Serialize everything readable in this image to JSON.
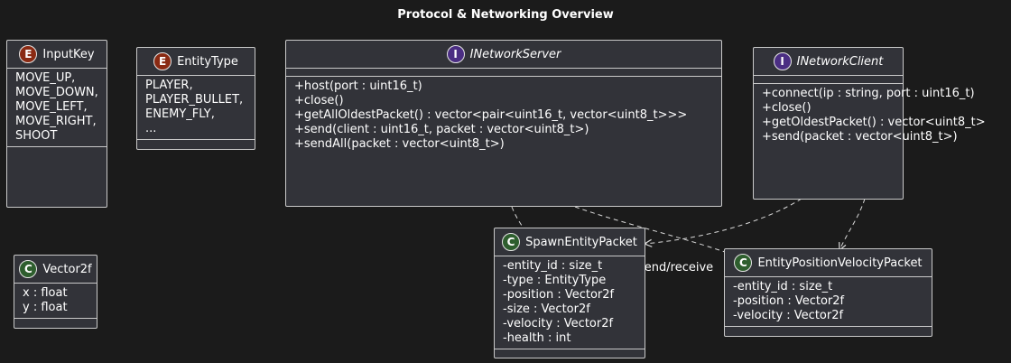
{
  "title": "Protocol & Networking Overview",
  "edge_label": "send/receive",
  "colors": {
    "background": "#1b1b1b",
    "box_fill": "#323339",
    "box_border": "#c9c9c9",
    "enum_badge": "#8a2a13",
    "interface_badge": "#4b2e83",
    "class_badge": "#2e5e2e"
  },
  "input_key": {
    "stereotype": "E",
    "name": "InputKey",
    "values": [
      "MOVE_UP,",
      "MOVE_DOWN,",
      "MOVE_LEFT,",
      "MOVE_RIGHT,",
      "SHOOT"
    ]
  },
  "entity_type": {
    "stereotype": "E",
    "name": "EntityType",
    "values": [
      "PLAYER,",
      "PLAYER_BULLET,",
      "ENEMY_FLY,",
      "..."
    ]
  },
  "network_server": {
    "stereotype": "I",
    "name": "INetworkServer",
    "methods": [
      "+host(port : uint16_t)",
      "+close()",
      "+getAllOldestPacket() : vector<pair<uint16_t, vector<uint8_t>>>",
      "+send(client : uint16_t, packet : vector<uint8_t>)",
      "+sendAll(packet : vector<uint8_t>)"
    ]
  },
  "network_client": {
    "stereotype": "I",
    "name": "INetworkClient",
    "methods": [
      "+connect(ip : string, port : uint16_t)",
      "+close()",
      "+getOldestPacket() : vector<uint8_t>",
      "+send(packet : vector<uint8_t>)"
    ]
  },
  "vector2f": {
    "stereotype": "C",
    "name": "Vector2f",
    "fields": [
      "x : float",
      "y : float"
    ]
  },
  "spawn_packet": {
    "stereotype": "C",
    "name": "SpawnEntityPacket",
    "fields": [
      "-entity_id : size_t",
      "-type : EntityType",
      "-position : Vector2f",
      "-size : Vector2f",
      "-velocity : Vector2f",
      "-health : int"
    ]
  },
  "position_packet": {
    "stereotype": "C",
    "name": "EntityPositionVelocityPacket",
    "fields": [
      "-entity_id : size_t",
      "-position : Vector2f",
      "-velocity : Vector2f"
    ]
  }
}
